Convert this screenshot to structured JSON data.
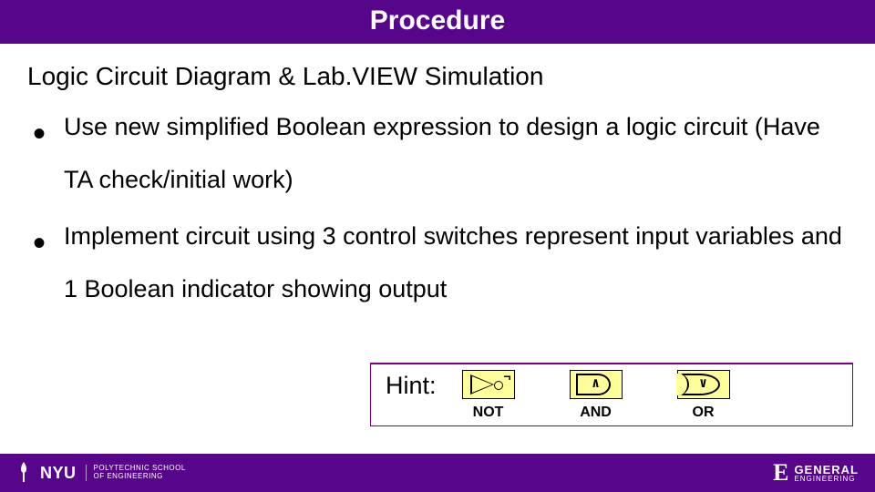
{
  "header": {
    "title": "Procedure"
  },
  "subtitle": "Logic Circuit Diagram & Lab.VIEW Simulation",
  "bullets": [
    "Use new simplified Boolean expression to design a logic circuit (Have TA check/initial work)",
    "Implement circuit using 3 control switches represent input variables and 1 Boolean indicator showing output"
  ],
  "hint": {
    "label": "Hint:",
    "gates": [
      {
        "symbol": "¬",
        "caption": "NOT"
      },
      {
        "symbol": "∧",
        "caption": "AND"
      },
      {
        "symbol": "∨",
        "caption": "OR"
      }
    ]
  },
  "footer": {
    "nyu": "NYU",
    "nyu_sub1": "POLYTECHNIC SCHOOL",
    "nyu_sub2": "OF ENGINEERING",
    "eg_e": "E",
    "eg_g": "GENERAL",
    "eg_eng": "ENGINEERING"
  }
}
